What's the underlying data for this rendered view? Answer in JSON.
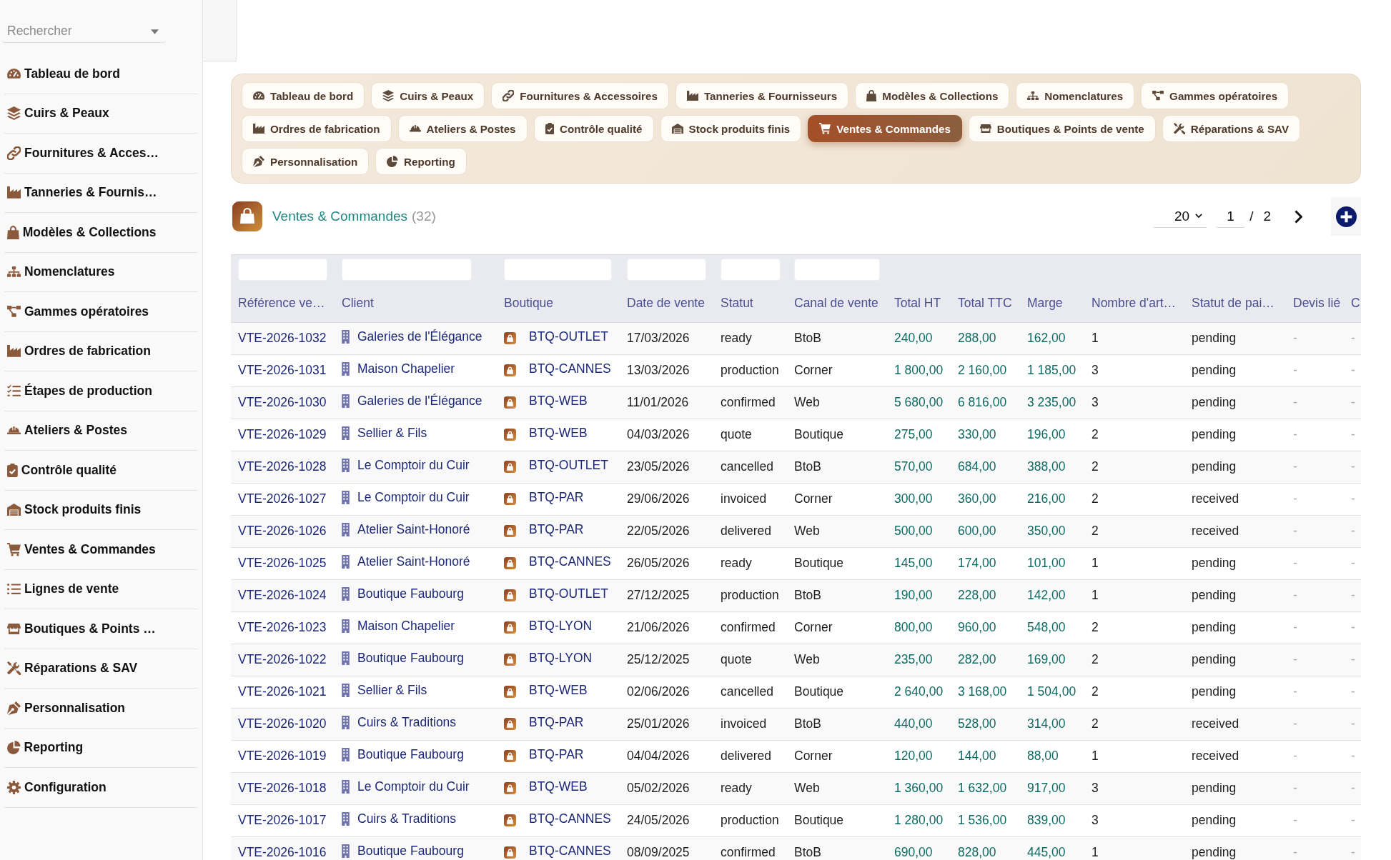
{
  "sidebar": {
    "search": {
      "placeholder": "Rechercher"
    },
    "items": [
      {
        "label": "Tableau de bord"
      },
      {
        "label": "Cuirs & Peaux"
      },
      {
        "label": "Fournitures & Acces…"
      },
      {
        "label": "Tanneries & Fournis…"
      },
      {
        "label": "Modèles & Collections"
      },
      {
        "label": "Nomenclatures"
      },
      {
        "label": "Gammes opératoires"
      },
      {
        "label": "Ordres de fabrication"
      },
      {
        "label": "Étapes de production"
      },
      {
        "label": "Ateliers & Postes"
      },
      {
        "label": "Contrôle qualité"
      },
      {
        "label": "Stock produits finis"
      },
      {
        "label": "Ventes & Commandes"
      },
      {
        "label": "Lignes de vente"
      },
      {
        "label": "Boutiques & Points …"
      },
      {
        "label": "Réparations & SAV"
      },
      {
        "label": "Personnalisation"
      },
      {
        "label": "Reporting"
      },
      {
        "label": "Configuration"
      }
    ]
  },
  "tabs": [
    {
      "label": "Tableau de bord",
      "selected": false
    },
    {
      "label": "Cuirs & Peaux",
      "selected": false
    },
    {
      "label": "Fournitures & Accessoires",
      "selected": false
    },
    {
      "label": "Tanneries & Fournisseurs",
      "selected": false
    },
    {
      "label": "Modèles & Collections",
      "selected": false
    },
    {
      "label": "Nomenclatures",
      "selected": false
    },
    {
      "label": "Gammes opératoires",
      "selected": false
    },
    {
      "label": "Ordres de fabrication",
      "selected": false
    },
    {
      "label": "Ateliers & Postes",
      "selected": false
    },
    {
      "label": "Contrôle qualité",
      "selected": false
    },
    {
      "label": "Stock produits finis",
      "selected": false
    },
    {
      "label": "Ventes & Commandes",
      "selected": true
    },
    {
      "label": "Boutiques & Points de vente",
      "selected": false
    },
    {
      "label": "Réparations & SAV",
      "selected": false
    },
    {
      "label": "Personnalisation",
      "selected": false
    },
    {
      "label": "Reporting",
      "selected": false
    }
  ],
  "list_header": {
    "title": "Ventes & Commandes",
    "count": "(32)",
    "page_size": "20",
    "page": "1",
    "page_separator": "/",
    "page_count": "2"
  },
  "table": {
    "columns": [
      {
        "label": "Référence ve…",
        "kind": "link",
        "filter": true
      },
      {
        "label": "Client",
        "kind": "client",
        "filter": true
      },
      {
        "label": "Boutique",
        "kind": "shop",
        "filter": true
      },
      {
        "label": "Date de vente",
        "kind": "text",
        "filter": true
      },
      {
        "label": "Statut",
        "kind": "text",
        "filter": true
      },
      {
        "label": "Canal de vente",
        "kind": "text",
        "filter": true
      },
      {
        "label": "Total HT",
        "kind": "amount",
        "filter": false
      },
      {
        "label": "Total TTC",
        "kind": "amount",
        "filter": false
      },
      {
        "label": "Marge",
        "kind": "amount",
        "filter": false
      },
      {
        "label": "Nombre d'art…",
        "kind": "text",
        "filter": false
      },
      {
        "label": "Statut de pai…",
        "kind": "text",
        "filter": false
      },
      {
        "label": "Devis lié",
        "kind": "empty",
        "filter": false
      },
      {
        "label": "C",
        "kind": "empty",
        "filter": false
      }
    ],
    "rows": [
      {
        "cells": [
          "VTE-2026-1032",
          "Galeries de l'Élégance",
          "BTQ-OUTLET",
          "17/03/2026",
          "ready",
          "BtoB",
          "240,00",
          "288,00",
          "162,00",
          "1",
          "pending",
          "-",
          "-"
        ]
      },
      {
        "cells": [
          "VTE-2026-1031",
          "Maison Chapelier",
          "BTQ-CANNES",
          "13/03/2026",
          "production",
          "Corner",
          "1 800,00",
          "2 160,00",
          "1 185,00",
          "3",
          "pending",
          "-",
          "-"
        ]
      },
      {
        "cells": [
          "VTE-2026-1030",
          "Galeries de l'Élégance",
          "BTQ-WEB",
          "11/01/2026",
          "confirmed",
          "Web",
          "5 680,00",
          "6 816,00",
          "3 235,00",
          "3",
          "pending",
          "-",
          "-"
        ]
      },
      {
        "cells": [
          "VTE-2026-1029",
          "Sellier & Fils",
          "BTQ-WEB",
          "04/03/2026",
          "quote",
          "Boutique",
          "275,00",
          "330,00",
          "196,00",
          "2",
          "pending",
          "-",
          "-"
        ]
      },
      {
        "cells": [
          "VTE-2026-1028",
          "Le Comptoir du Cuir",
          "BTQ-OUTLET",
          "23/05/2026",
          "cancelled",
          "BtoB",
          "570,00",
          "684,00",
          "388,00",
          "2",
          "pending",
          "-",
          "-"
        ]
      },
      {
        "cells": [
          "VTE-2026-1027",
          "Le Comptoir du Cuir",
          "BTQ-PAR",
          "29/06/2026",
          "invoiced",
          "Corner",
          "300,00",
          "360,00",
          "216,00",
          "2",
          "received",
          "-",
          "-"
        ]
      },
      {
        "cells": [
          "VTE-2026-1026",
          "Atelier Saint-Honoré",
          "BTQ-PAR",
          "22/05/2026",
          "delivered",
          "Web",
          "500,00",
          "600,00",
          "350,00",
          "2",
          "received",
          "-",
          "-"
        ]
      },
      {
        "cells": [
          "VTE-2026-1025",
          "Atelier Saint-Honoré",
          "BTQ-CANNES",
          "26/05/2026",
          "ready",
          "Boutique",
          "145,00",
          "174,00",
          "101,00",
          "1",
          "pending",
          "-",
          "-"
        ]
      },
      {
        "cells": [
          "VTE-2026-1024",
          "Boutique Faubourg",
          "BTQ-OUTLET",
          "27/12/2025",
          "production",
          "BtoB",
          "190,00",
          "228,00",
          "142,00",
          "1",
          "pending",
          "-",
          "-"
        ]
      },
      {
        "cells": [
          "VTE-2026-1023",
          "Maison Chapelier",
          "BTQ-LYON",
          "21/06/2026",
          "confirmed",
          "Corner",
          "800,00",
          "960,00",
          "548,00",
          "2",
          "pending",
          "-",
          "-"
        ]
      },
      {
        "cells": [
          "VTE-2026-1022",
          "Boutique Faubourg",
          "BTQ-LYON",
          "25/12/2025",
          "quote",
          "Web",
          "235,00",
          "282,00",
          "169,00",
          "2",
          "pending",
          "-",
          "-"
        ]
      },
      {
        "cells": [
          "VTE-2026-1021",
          "Sellier & Fils",
          "BTQ-WEB",
          "02/06/2026",
          "cancelled",
          "Boutique",
          "2 640,00",
          "3 168,00",
          "1 504,00",
          "2",
          "pending",
          "-",
          "-"
        ]
      },
      {
        "cells": [
          "VTE-2026-1020",
          "Cuirs & Traditions",
          "BTQ-PAR",
          "25/01/2026",
          "invoiced",
          "BtoB",
          "440,00",
          "528,00",
          "314,00",
          "2",
          "received",
          "-",
          "-"
        ]
      },
      {
        "cells": [
          "VTE-2026-1019",
          "Boutique Faubourg",
          "BTQ-PAR",
          "04/04/2026",
          "delivered",
          "Corner",
          "120,00",
          "144,00",
          "88,00",
          "1",
          "received",
          "-",
          "-"
        ]
      },
      {
        "cells": [
          "VTE-2026-1018",
          "Le Comptoir du Cuir",
          "BTQ-WEB",
          "05/02/2026",
          "ready",
          "Web",
          "1 360,00",
          "1 632,00",
          "917,00",
          "3",
          "pending",
          "-",
          "-"
        ]
      },
      {
        "cells": [
          "VTE-2026-1017",
          "Cuirs & Traditions",
          "BTQ-CANNES",
          "24/05/2026",
          "production",
          "Boutique",
          "1 280,00",
          "1 536,00",
          "839,00",
          "3",
          "pending",
          "-",
          "-"
        ]
      },
      {
        "cells": [
          "VTE-2026-1016",
          "Boutique Faubourg",
          "BTQ-CANNES",
          "08/09/2025",
          "confirmed",
          "BtoB",
          "690,00",
          "828,00",
          "445,00",
          "1",
          "pending",
          "-",
          "-"
        ]
      }
    ]
  }
}
